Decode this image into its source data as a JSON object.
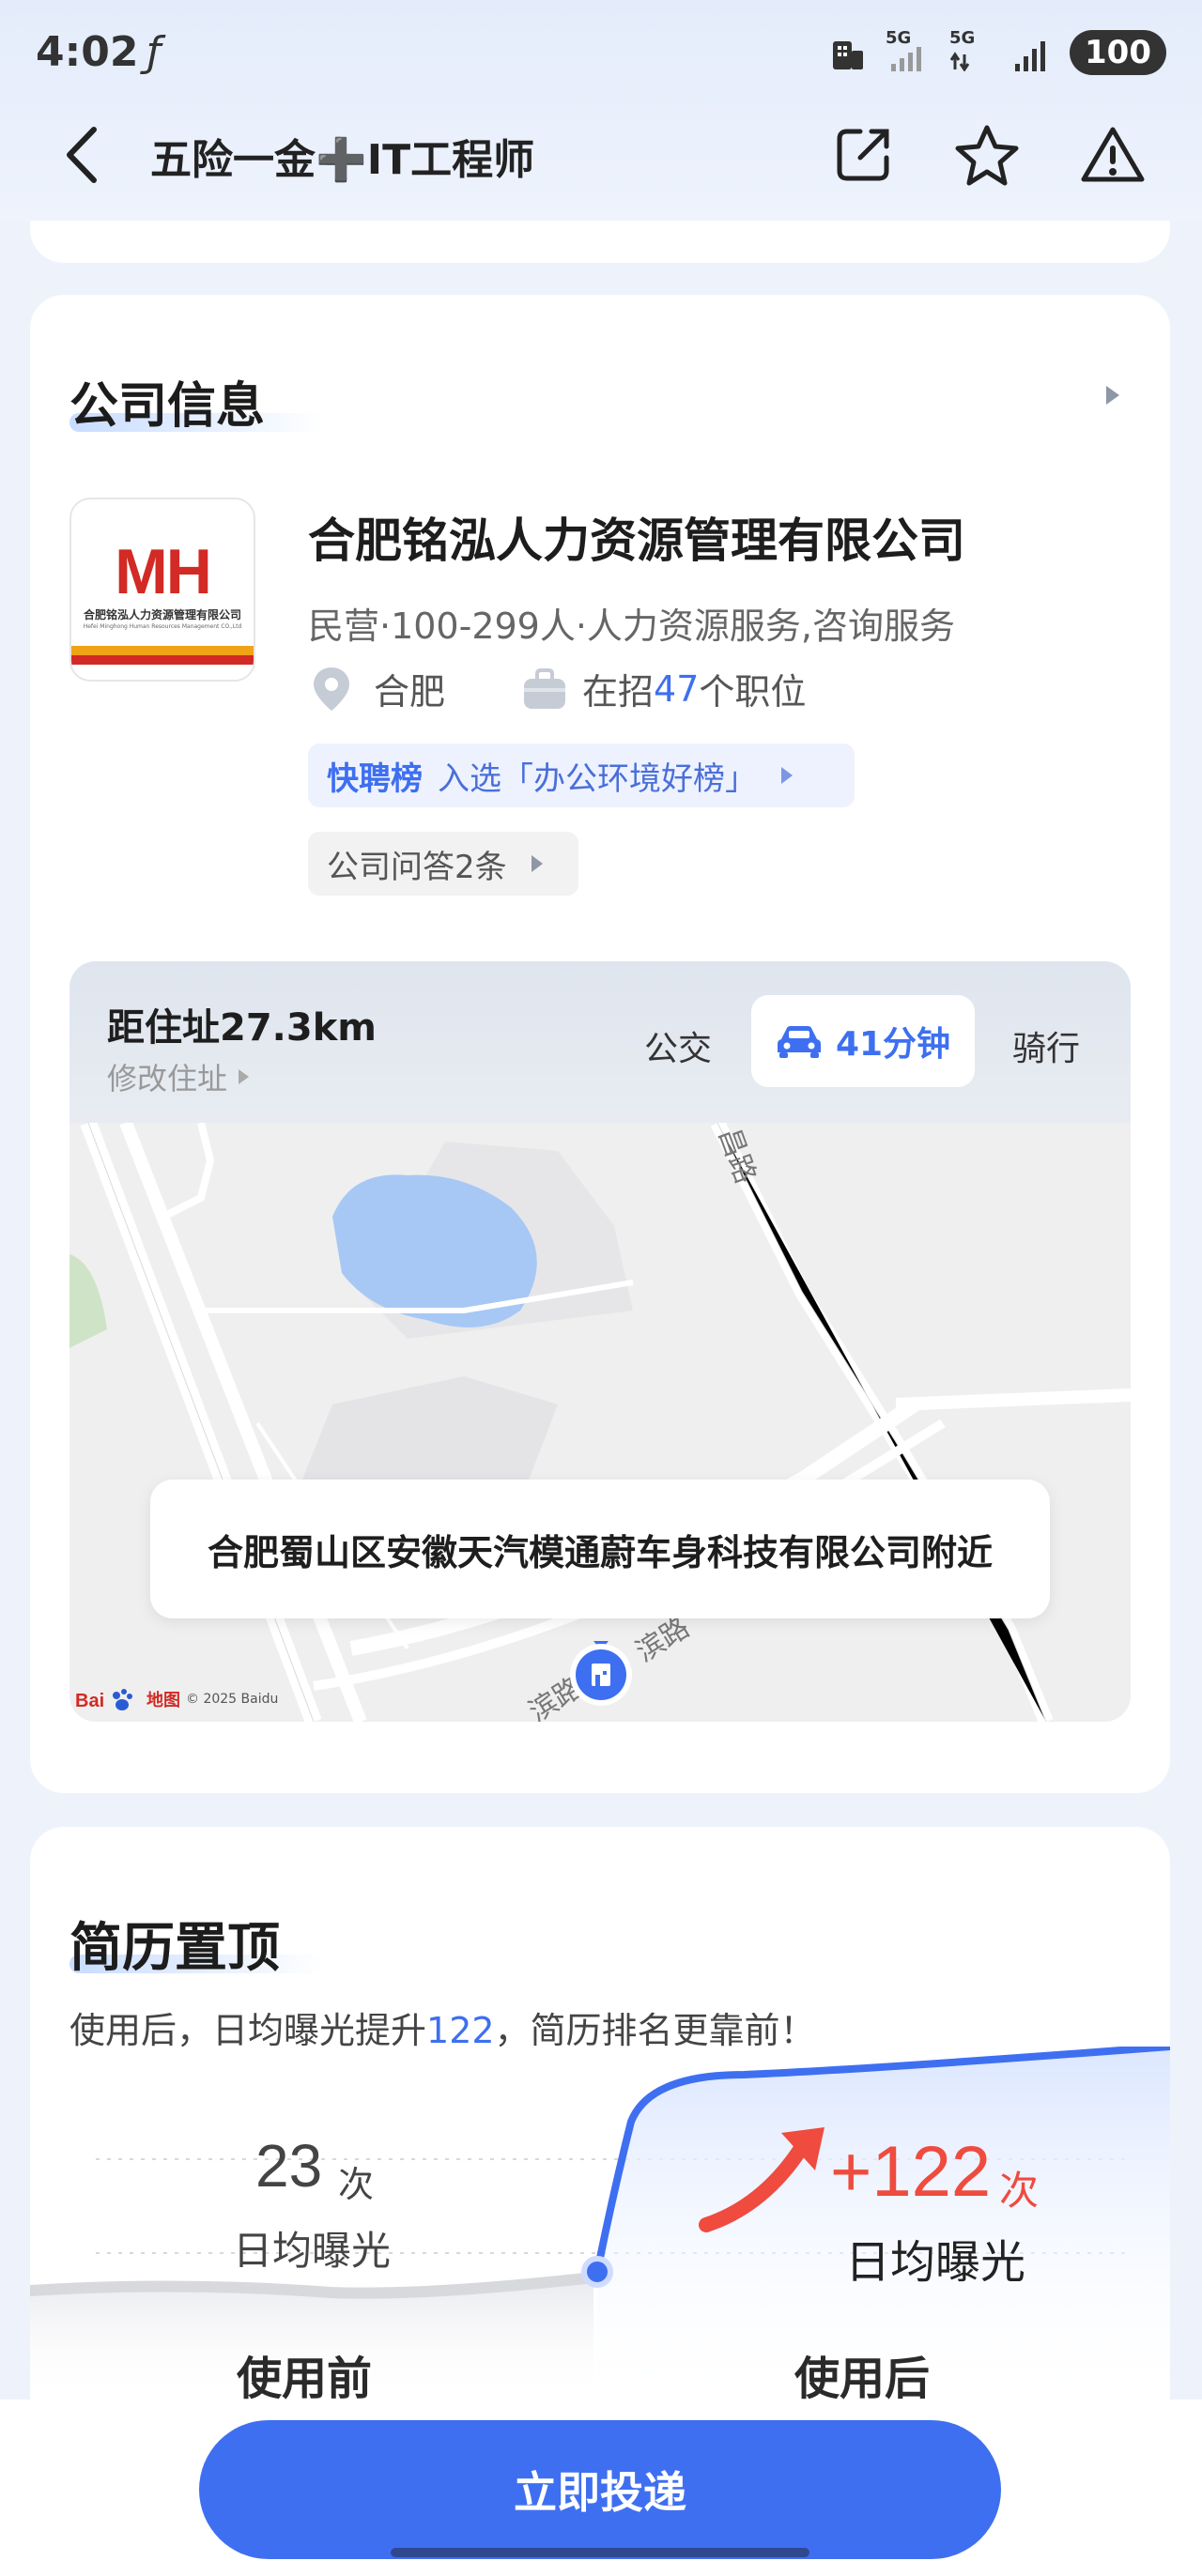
{
  "status_bar": {
    "time": "4:02",
    "network_1": "5G",
    "network_2": "5G",
    "battery": "100"
  },
  "nav": {
    "title": "五险一金➕IT工程师",
    "icons": [
      "back-icon",
      "share-icon",
      "star-icon",
      "warning-icon"
    ]
  },
  "company": {
    "section_title": "公司信息",
    "logo_text": "MH",
    "logo_cn": "合肥铭泓人力资源管理有限公司",
    "logo_en": "Hefei Minghong Human Resources Management CO.,Ltd",
    "name": "合肥铭泓人力资源管理有限公司",
    "meta": "民营·100-299人·人力资源服务,咨询服务",
    "city": "合肥",
    "jobs_prefix": "在招",
    "jobs_count": "47",
    "jobs_suffix": "个职位",
    "rank_strong": "快聘榜",
    "rank_text": "入选「办公环境好榜」",
    "qa_text": "公司问答2条"
  },
  "map": {
    "distance": "距住址27.3km",
    "edit_address": "修改住址",
    "mode_bus": "公交",
    "mode_car": "41分钟",
    "mode_bike": "骑行",
    "location_label": "合肥蜀山区安徽天汽模通蔚车身科技有限公司附近",
    "roads": [
      "昌路",
      "昌路",
      "滨路",
      "滨路",
      "滨路",
      "滨路"
    ],
    "baidu_label": "地图",
    "copyright": "© 2025 Baidu"
  },
  "resume_top": {
    "section_title": "简历置顶",
    "subtitle_prefix": "使用后，日均曝光提升",
    "subtitle_num": "122",
    "subtitle_suffix": "，简历排名更靠前！",
    "before_value": "23",
    "before_unit": "次",
    "before_label": "日均曝光",
    "after_value": "+122",
    "after_unit": "次",
    "after_label": "日均曝光",
    "before_period": "使用前",
    "after_period": "使用后"
  },
  "cta": {
    "apply_label": "立即投递"
  },
  "colors": {
    "accent": "#3f6ff1",
    "highlight_red": "#ef4b3f",
    "page_bg": "#eef3fb"
  }
}
